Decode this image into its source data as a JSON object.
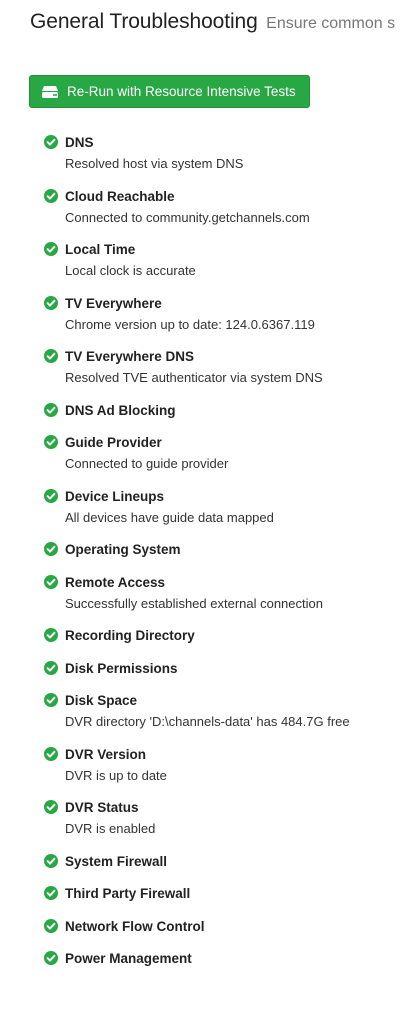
{
  "header": {
    "title": "General Troubleshooting",
    "subtitle": "Ensure common s"
  },
  "run_button": {
    "label": "Re-Run with Resource Intensive Tests",
    "icon": "server-icon"
  },
  "colors": {
    "success": "#28a745",
    "button_bg": "#28a745"
  },
  "checks": [
    {
      "name": "DNS",
      "detail": "Resolved host via system DNS"
    },
    {
      "name": "Cloud Reachable",
      "detail": "Connected to community.getchannels.com"
    },
    {
      "name": "Local Time",
      "detail": "Local clock is accurate"
    },
    {
      "name": "TV Everywhere",
      "detail": "Chrome version up to date: 124.0.6367.119"
    },
    {
      "name": "TV Everywhere DNS",
      "detail": "Resolved TVE authenticator via system DNS"
    },
    {
      "name": "DNS Ad Blocking",
      "detail": ""
    },
    {
      "name": "Guide Provider",
      "detail": "Connected to guide provider"
    },
    {
      "name": "Device Lineups",
      "detail": "All devices have guide data mapped"
    },
    {
      "name": "Operating System",
      "detail": ""
    },
    {
      "name": "Remote Access",
      "detail": "Successfully established external connection"
    },
    {
      "name": "Recording Directory",
      "detail": ""
    },
    {
      "name": "Disk Permissions",
      "detail": ""
    },
    {
      "name": "Disk Space",
      "detail": "DVR directory 'D:\\channels-data' has 484.7G free"
    },
    {
      "name": "DVR Version",
      "detail": "DVR is up to date"
    },
    {
      "name": "DVR Status",
      "detail": "DVR is enabled"
    },
    {
      "name": "System Firewall",
      "detail": ""
    },
    {
      "name": "Third Party Firewall",
      "detail": ""
    },
    {
      "name": "Network Flow Control",
      "detail": ""
    },
    {
      "name": "Power Management",
      "detail": ""
    }
  ]
}
